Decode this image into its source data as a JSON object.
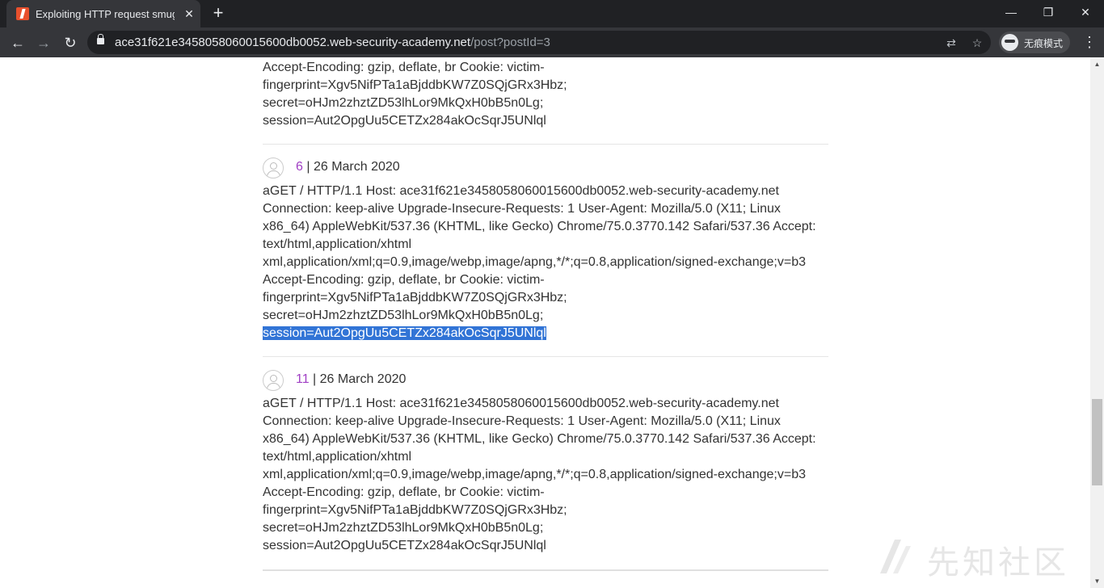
{
  "browser": {
    "tab": {
      "title": "Exploiting HTTP request smuggling",
      "close_glyph": "✕",
      "favicon": "burp-logo-icon"
    },
    "newtab_glyph": "+",
    "window_controls": {
      "minimize": "—",
      "restore": "❐",
      "close": "✕"
    },
    "nav": {
      "back": "←",
      "forward": "→",
      "reload": "↻"
    },
    "omnibox": {
      "host": "ace31f621e3458058060015600db0052.web-security-academy.net",
      "path": "/post?postId=3",
      "translate_glyph": "⇄",
      "bookmark_glyph": "☆"
    },
    "profile_label": "无痕模式",
    "menu_glyph": "⋮"
  },
  "comments": {
    "top_partial": {
      "lines": [
        "Accept-Encoding: gzip, deflate, br Cookie: victim-",
        "fingerprint=Xgv5NifPTa1aBjddbKW7Z0SQjGRx3Hbz;",
        "secret=oHJm2zhztZD53lhLor9MkQxH0bB5n0Lg;",
        "session=Aut2OpgUu5CETZx284akOcSqrJ5UNlql"
      ]
    },
    "items": [
      {
        "author": "6",
        "date_sep": " | ",
        "date": "26 March 2020",
        "lines": [
          "aGET / HTTP/1.1 Host: ace31f621e3458058060015600db0052.web-security-academy.net",
          "Connection: keep-alive Upgrade-Insecure-Requests: 1 User-Agent: Mozilla/5.0 (X11; Linux",
          "x86_64) AppleWebKit/537.36 (KHTML, like Gecko) Chrome/75.0.3770.142 Safari/537.36 Accept:",
          "text/html,application/xhtml",
          "xml,application/xml;q=0.9,image/webp,image/apng,*/*;q=0.8,application/signed-exchange;v=b3",
          "Accept-Encoding: gzip, deflate, br Cookie: victim-",
          "fingerprint=Xgv5NifPTa1aBjddbKW7Z0SQjGRx3Hbz;",
          "secret=oHJm2zhztZD53lhLor9MkQxH0bB5n0Lg;"
        ],
        "highlighted_line": "session=Aut2OpgUu5CETZx284akOcSqrJ5UNlql"
      },
      {
        "author": "11",
        "date_sep": " | ",
        "date": "26 March 2020",
        "lines": [
          "aGET / HTTP/1.1 Host: ace31f621e3458058060015600db0052.web-security-academy.net",
          "Connection: keep-alive Upgrade-Insecure-Requests: 1 User-Agent: Mozilla/5.0 (X11; Linux",
          "x86_64) AppleWebKit/537.36 (KHTML, like Gecko) Chrome/75.0.3770.142 Safari/537.36 Accept:",
          "text/html,application/xhtml",
          "xml,application/xml;q=0.9,image/webp,image/apng,*/*;q=0.8,application/signed-exchange;v=b3",
          "Accept-Encoding: gzip, deflate, br Cookie: victim-",
          "fingerprint=Xgv5NifPTa1aBjddbKW7Z0SQjGRx3Hbz;",
          "secret=oHJm2zhztZD53lhLor9MkQxH0bB5n0Lg;",
          "session=Aut2OpgUu5CETZx284akOcSqrJ5UNlql"
        ]
      }
    ]
  },
  "watermark": {
    "text": "先知社区"
  },
  "colors": {
    "author_link": "#a03fc4",
    "selection": "#3174d6",
    "chrome_dark": "#202124",
    "chrome_toolbar": "#35363a"
  }
}
